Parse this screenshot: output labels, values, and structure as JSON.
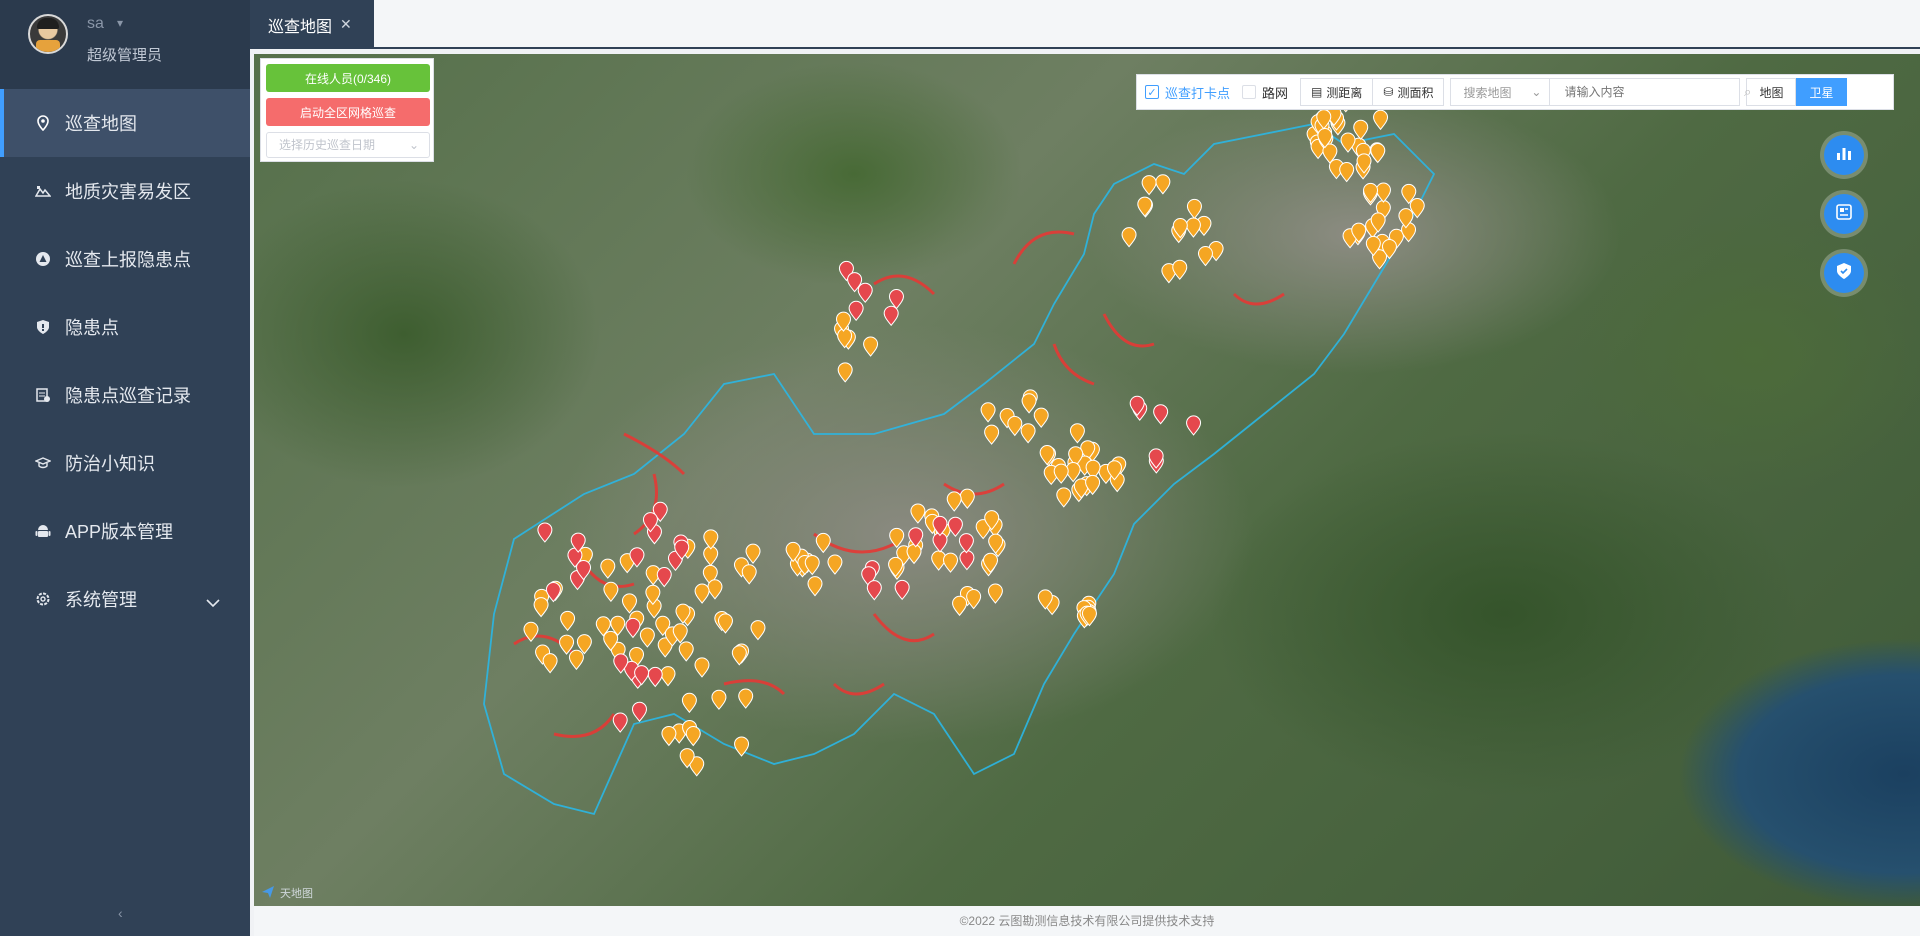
{
  "user": {
    "name": "sa",
    "role": "超级管理员"
  },
  "sidebar": {
    "items": [
      {
        "label": "巡查地图",
        "icon": "location-icon",
        "active": true
      },
      {
        "label": "地质灾害易发区",
        "icon": "terrain-icon"
      },
      {
        "label": "巡查上报隐患点",
        "icon": "warning-triangle-icon"
      },
      {
        "label": "隐患点",
        "icon": "shield-icon"
      },
      {
        "label": "隐患点巡查记录",
        "icon": "record-icon"
      },
      {
        "label": "防治小知识",
        "icon": "graduation-cap-icon"
      },
      {
        "label": "APP版本管理",
        "icon": "android-icon"
      },
      {
        "label": "系统管理",
        "icon": "gear-icon",
        "expandable": true
      }
    ],
    "collapse_label": "‹"
  },
  "tabs": [
    {
      "label": "巡查地图",
      "closable": true
    }
  ],
  "map_panel": {
    "online_button": "在线人员(0/346)",
    "grid_patrol_button": "启动全区网格巡查",
    "history_date_placeholder": "选择历史巡查日期"
  },
  "toolbar": {
    "checkin_label": "巡查打卡点",
    "checkin_checked": true,
    "roadnet_label": "路网",
    "roadnet_checked": false,
    "measure_distance": "测距离",
    "measure_area": "测面积",
    "search_type": "搜索地图",
    "search_placeholder": "请输入内容",
    "map_type_map": "地图",
    "map_type_satellite": "卫星",
    "active_map_type": "卫星"
  },
  "fabs": [
    "chart-icon",
    "document-card-icon",
    "shield-badge-icon"
  ],
  "map_attribution": "天地图",
  "footer": "©2022 云图勘测信息技术有限公司提供技术支持",
  "colors": {
    "sidebar_bg": "#304156",
    "active_accent": "#409eff",
    "online_green": "#67c23a",
    "alert_red": "#f56c6c",
    "marker_orange": "#f5a623",
    "marker_red": "#e5484d",
    "boundary_blue": "#2ab7e6"
  }
}
